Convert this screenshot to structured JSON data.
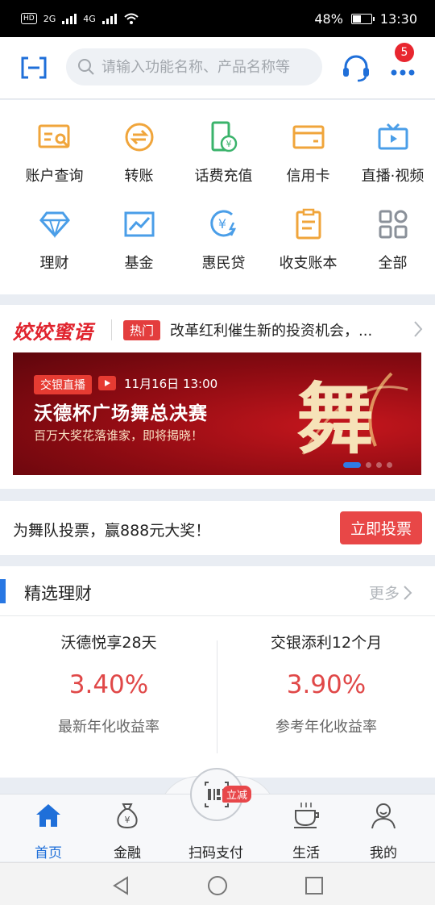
{
  "status_bar": {
    "left_hd": "HD",
    "net_a": "2G",
    "net_b": "4G",
    "battery_percent": "48%",
    "battery_level": 0.48,
    "time": "13:30"
  },
  "header": {
    "search_placeholder": "请输入功能名称、产品名称等",
    "notification_count": "5"
  },
  "quick_actions": [
    {
      "label": "账户查询",
      "icon": "account-query-icon",
      "color": "#f0a53b"
    },
    {
      "label": "转账",
      "icon": "transfer-icon",
      "color": "#f0a53b"
    },
    {
      "label": "话费充值",
      "icon": "phone-recharge-icon",
      "color": "#3ab36b"
    },
    {
      "label": "信用卡",
      "icon": "credit-card-icon",
      "color": "#f0a53b"
    },
    {
      "label": "直播·视频",
      "icon": "live-tv-icon",
      "color": "#4a9ee8"
    },
    {
      "label": "理财",
      "icon": "diamond-icon",
      "color": "#4a9ee8"
    },
    {
      "label": "基金",
      "icon": "fund-chart-icon",
      "color": "#4a9ee8"
    },
    {
      "label": "惠民贷",
      "icon": "loan-icon",
      "color": "#4a9ee8"
    },
    {
      "label": "收支账本",
      "icon": "ledger-icon",
      "color": "#f0a53b"
    },
    {
      "label": "全部",
      "icon": "grid-all-icon",
      "color": "#8a9099"
    }
  ],
  "news": {
    "brand": "姣姣蜜语",
    "tag": "热门",
    "headline": "改革红利催生新的投资机会，..."
  },
  "banner": {
    "tag": "交银直播",
    "datetime": "11月16日 13:00",
    "title": "沃德杯广场舞总决赛",
    "subtitle": "百万大奖花落谁家，即将揭晓！",
    "art_text": "舞"
  },
  "vote": {
    "text": "为舞队投票，赢888元大奖！",
    "button": "立即投票"
  },
  "picks": {
    "title": "精选理财",
    "more": "更多",
    "products": [
      {
        "name": "沃德悦享28天",
        "rate": "3.40%",
        "desc": "最新年化收益率"
      },
      {
        "name": "交银添利12个月",
        "rate": "3.90%",
        "desc": "参考年化收益率"
      }
    ]
  },
  "tabbar": {
    "tabs": [
      {
        "label": "首页",
        "icon": "home-icon"
      },
      {
        "label": "金融",
        "icon": "money-bag-icon"
      },
      {
        "label": "扫码支付",
        "icon": "qr-pay-icon"
      },
      {
        "label": "生活",
        "icon": "coffee-cup-icon"
      },
      {
        "label": "我的",
        "icon": "profile-icon"
      }
    ],
    "promo_badge": "立减",
    "active_color": "#1f6fd9"
  },
  "colors": {
    "accent_blue": "#2877e3",
    "accent_red": "#e84747"
  }
}
